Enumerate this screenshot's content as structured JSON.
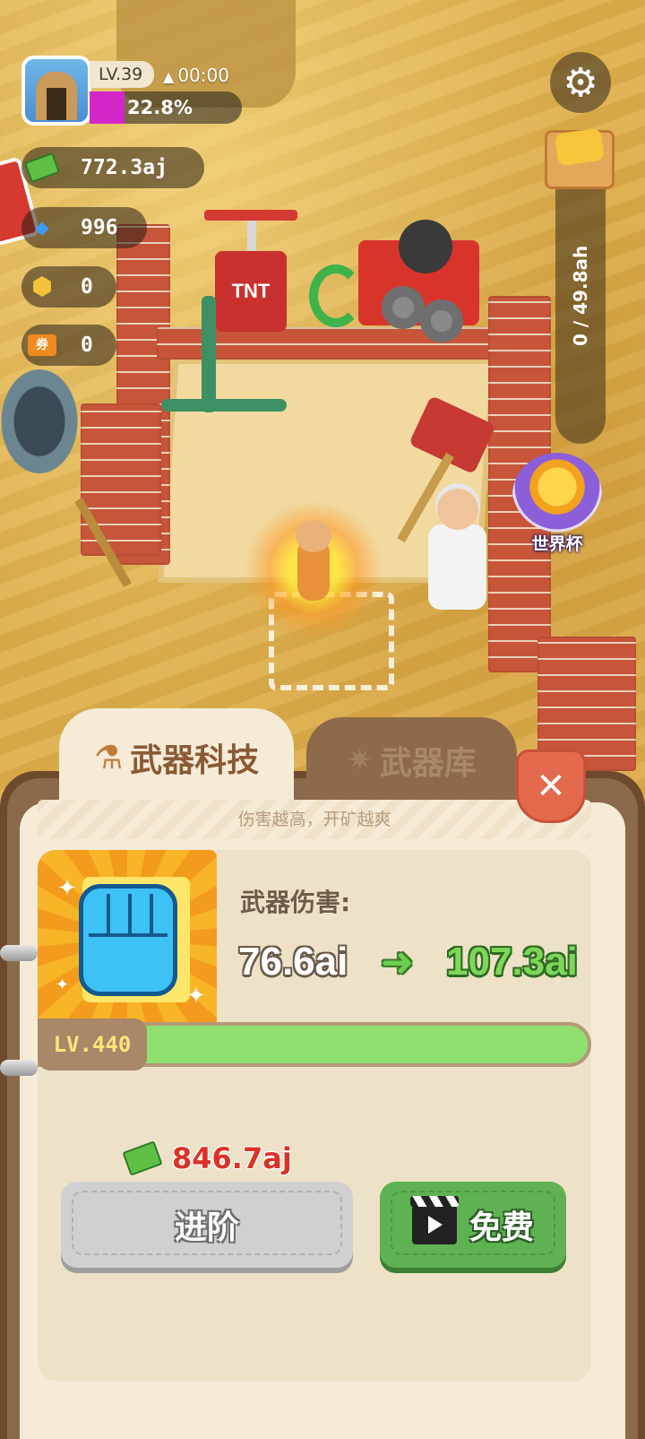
{
  "hud": {
    "level": "LV.39",
    "timer": "00:00",
    "progress_text": "22.8%",
    "progress": 0.228,
    "cash": "772.3aj",
    "gems": "996",
    "gold": "0",
    "tickets": "0",
    "ticket_label": "券",
    "gold_gauge": "0 / 49.8ah"
  },
  "scene": {
    "tnt_label": "TNT",
    "world_cup_label": "世界杯"
  },
  "panel": {
    "tab_tech": "武器科技",
    "tab_armory": "武器库",
    "subtitle": "伤害越高，开矿越爽",
    "stat_label": "武器伤害:",
    "stat_old": "76.6ai",
    "stat_new": "107.3ai",
    "level": "LV.440",
    "cost": "846.7aj",
    "advance_label": "进阶",
    "free_label": "免费",
    "close_label": "✕"
  },
  "icons": {
    "settings": "gear-icon",
    "cash": "cash-icon",
    "gem": "diamond-icon",
    "gold": "gold-nugget-icon",
    "ticket": "ticket-icon",
    "tech": "flask-icon",
    "armory": "dynamite-icon",
    "weapon": "fist-icon",
    "video": "clapperboard-icon"
  },
  "colors": {
    "progress_fill": "#d326c9",
    "upgrade_value": "#7ed65a",
    "cost": "#d93228",
    "free_button": "#5fb252"
  }
}
